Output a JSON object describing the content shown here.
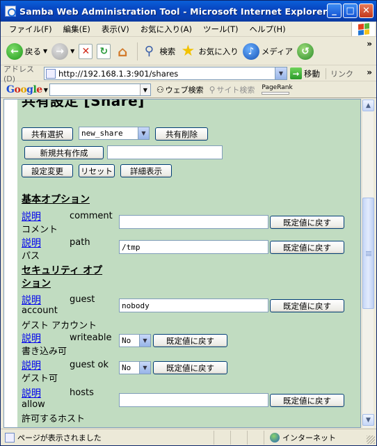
{
  "window": {
    "title": "Samba Web Administration Tool - Microsoft Internet Explorer",
    "minimize": "_",
    "maximize": "□",
    "close": "✕"
  },
  "menu": [
    "ファイル(F)",
    "編集(E)",
    "表示(V)",
    "お気に入り(A)",
    "ツール(T)",
    "ヘルプ(H)"
  ],
  "toolbar": {
    "back": "戻る",
    "search": "検索",
    "favorites": "お気に入り",
    "media": "メディア",
    "more": "»"
  },
  "address": {
    "label": "アドレス(D)",
    "url": "http://192.168.1.3:901/shares",
    "go": "移動",
    "links": "リンク",
    "more": "»"
  },
  "google": {
    "logo": [
      "G",
      "o",
      "o",
      "g",
      "l",
      "e"
    ],
    "web_search": "ウェブ検索",
    "site_search": "サイト検索",
    "pagerank": "PageRank"
  },
  "page": {
    "heading": "共有設定 [Share]",
    "select_share_button": "共有選択",
    "share_select_value": "new_share",
    "delete_share_button": "共有削除",
    "create_share_button": "新規共有作成",
    "create_share_value": "",
    "commit_button": "設定変更",
    "reset_button": "リセット",
    "advanced_button": "詳細表示",
    "basic_section": "基本オプション",
    "security_section_line1": "セキュリティ オプ",
    "security_section_line2": "ション",
    "help_link": "説明",
    "default_button": "既定値に戻す",
    "params": [
      {
        "name": "comment",
        "label": "コメント",
        "value": ""
      },
      {
        "name": "path",
        "label": "パス",
        "value": "/tmp"
      },
      {
        "name": "guest",
        "name2": "account",
        "label": "ゲスト アカウント",
        "value": "nobody"
      },
      {
        "name": "writeable",
        "label": "書き込み可",
        "value": "No"
      },
      {
        "name": "guest ok",
        "label": "ゲスト可",
        "value": "No"
      },
      {
        "name": "hosts",
        "name2": "allow",
        "label": "許可するホスト",
        "value": ""
      }
    ]
  },
  "status": {
    "text": "ページが表示されました",
    "zone": "インターネット"
  }
}
